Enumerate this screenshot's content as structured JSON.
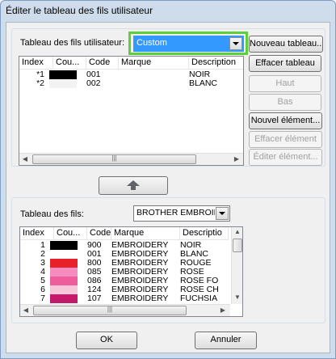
{
  "window": {
    "title": "Éditer le tableau des fils utilisateur"
  },
  "user_table": {
    "label": "Tableau des fils utilisateur:",
    "selected": "Custom",
    "columns": [
      "Index",
      "Cou...",
      "Code",
      "Marque",
      "Description"
    ],
    "rows": [
      {
        "index": "*1",
        "color": "#000000",
        "code": "001",
        "brand": "",
        "description": "NOIR"
      },
      {
        "index": "*2",
        "color": "#f2f2f2",
        "code": "002",
        "brand": "",
        "description": "BLANC"
      }
    ],
    "highlight_color": "#5ccf3a"
  },
  "side_buttons": {
    "new_table": "Nouveau tableau...",
    "delete_table": "Effacer tableau",
    "up": "Haut",
    "down": "Bas",
    "new_element": "Nouvel élément...",
    "delete_element": "Effacer élément",
    "edit_element": "Éditer élément..."
  },
  "arrow_up_icon": "arrow-up",
  "thread_table": {
    "label": "Tableau des fils:",
    "selected": "BROTHER EMBROIDEF",
    "columns": [
      "Index",
      "Cou...",
      "Code",
      "Marque",
      "Descriptio"
    ],
    "rows": [
      {
        "index": "1",
        "color": "#000000",
        "code": "900",
        "brand": "EMBROIDERY",
        "description": "NOIR"
      },
      {
        "index": "2",
        "color": "#ffffff",
        "code": "001",
        "brand": "EMBROIDERY",
        "description": "BLANC"
      },
      {
        "index": "3",
        "color": "#e8202a",
        "code": "800",
        "brand": "EMBROIDERY",
        "description": "ROUGE"
      },
      {
        "index": "4",
        "color": "#f48cbf",
        "code": "085",
        "brand": "EMBROIDERY",
        "description": "ROSE"
      },
      {
        "index": "5",
        "color": "#ee5d9c",
        "code": "086",
        "brand": "EMBROIDERY",
        "description": "ROSE FO"
      },
      {
        "index": "6",
        "color": "#f6c7d8",
        "code": "124",
        "brand": "EMBROIDERY",
        "description": "ROSE CH"
      },
      {
        "index": "7",
        "color": "#c41a6e",
        "code": "107",
        "brand": "EMBROIDERY",
        "description": "FUCHSIA"
      }
    ]
  },
  "footer": {
    "ok": "OK",
    "cancel": "Annuler"
  }
}
